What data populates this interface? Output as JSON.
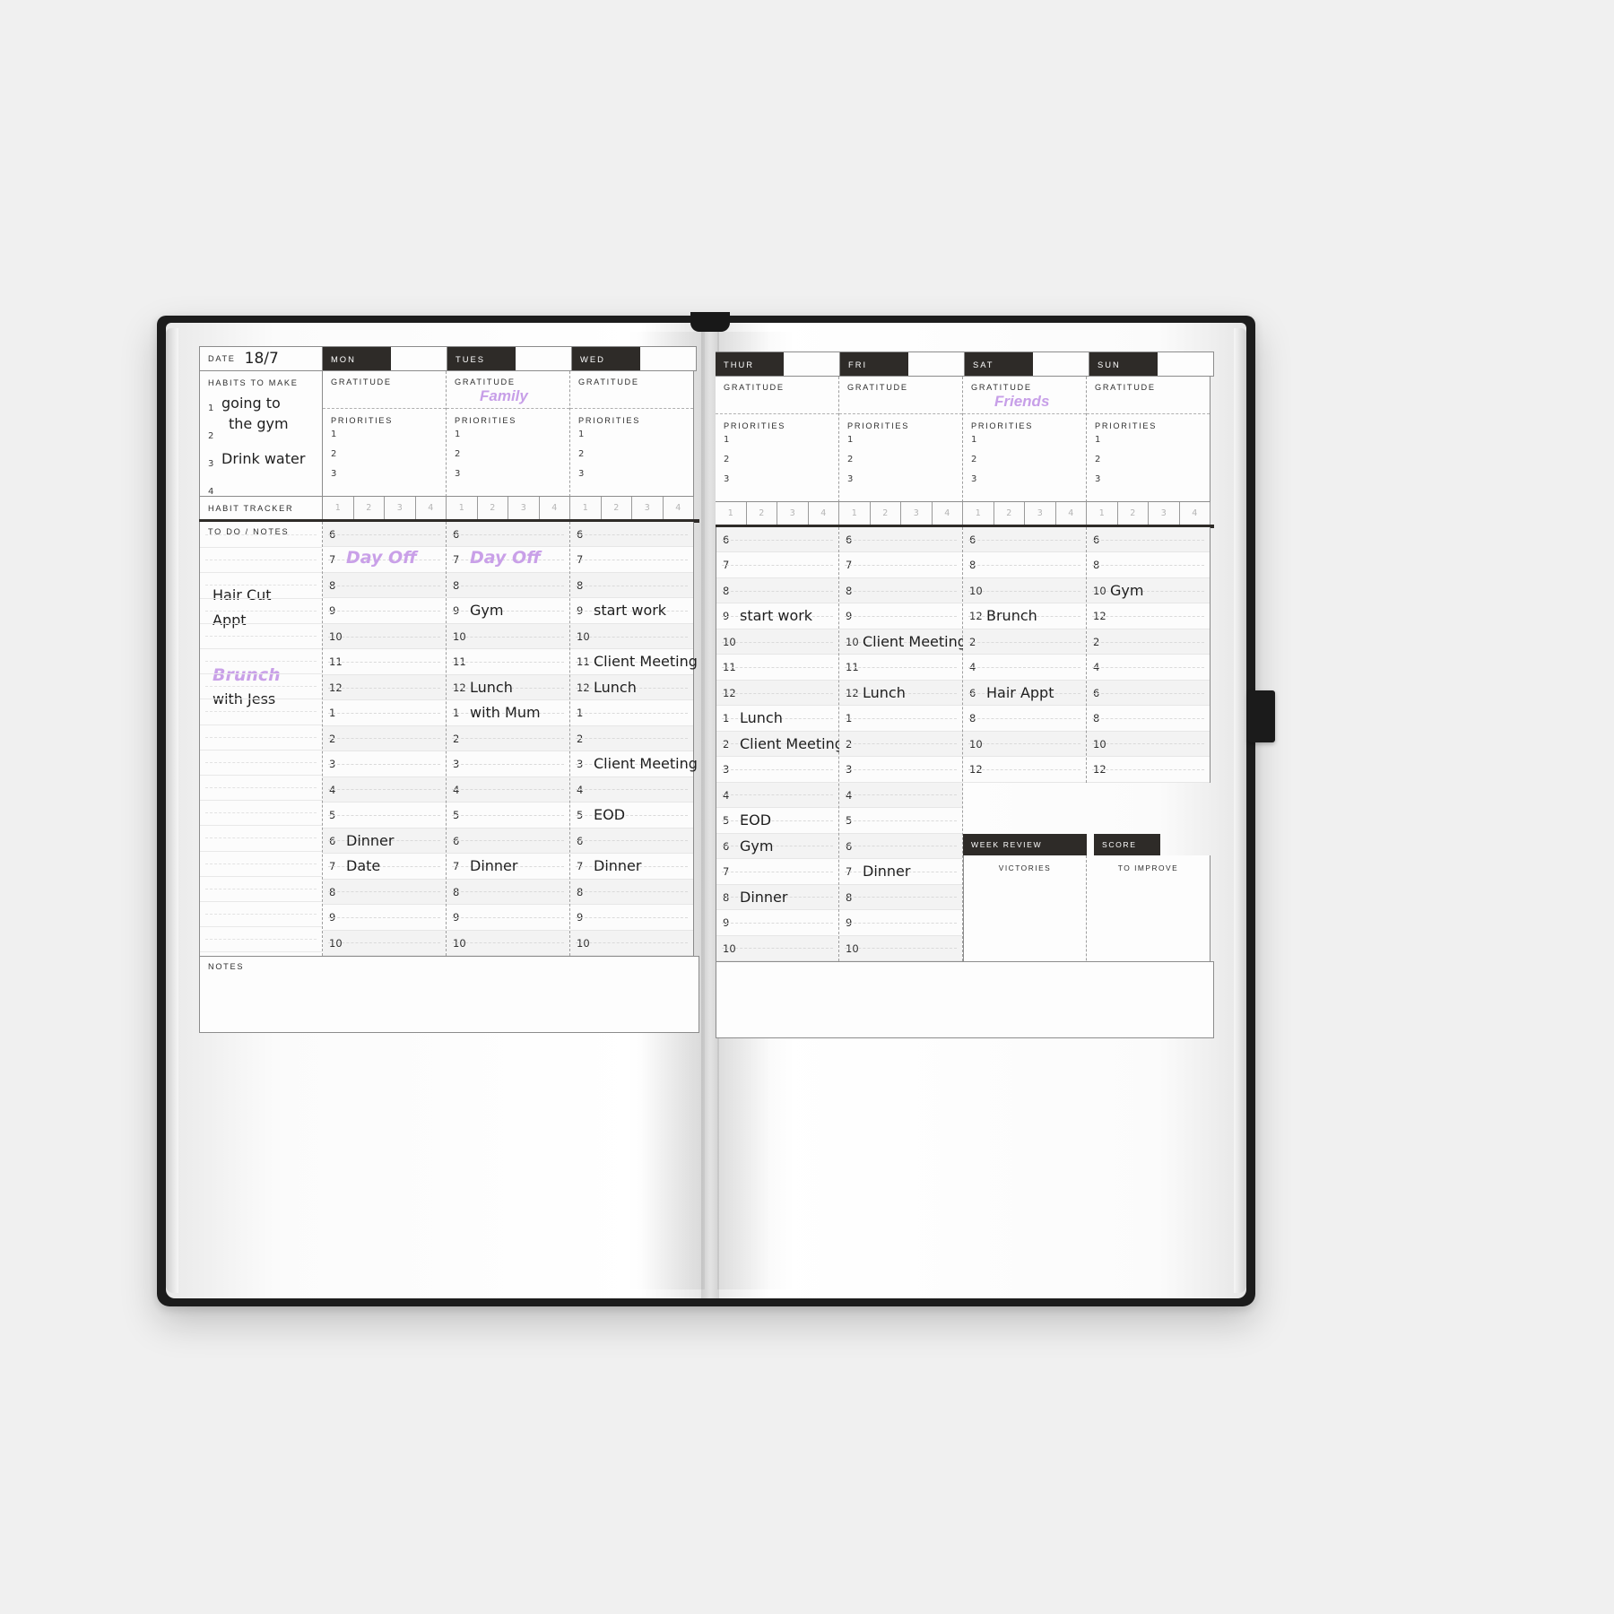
{
  "planner": {
    "date_label": "DATE",
    "date_value": "18/7",
    "habits_label": "HABITS TO MAKE",
    "habits": [
      {
        "num": "1",
        "text": "going to"
      },
      {
        "num": "2",
        "text": "the gym"
      },
      {
        "num": "3",
        "text": "Drink water"
      },
      {
        "num": "4",
        "text": ""
      }
    ],
    "habit_tracker_label": "HABIT TRACKER",
    "habit_tracker_nums": [
      "1",
      "2",
      "3",
      "4"
    ],
    "gratitude_label": "GRATITUDE",
    "priorities_label": "PRIORITIES",
    "priority_nums": [
      "1",
      "2",
      "3"
    ],
    "todo_label": "TO DO / NOTES",
    "notes_label": "NOTES",
    "todo_entries": [
      {
        "text": "Hair Cut",
        "style": "ink"
      },
      {
        "text": "Appt",
        "style": "ink"
      },
      {
        "text": "Brunch",
        "style": "purple"
      },
      {
        "text": "with Jess",
        "style": "ink"
      }
    ],
    "week_review": {
      "title": "WEEK REVIEW",
      "score": "SCORE",
      "victories": "VICTORIES",
      "to_improve": "TO IMPROVE"
    },
    "days": [
      {
        "key": "mon",
        "name": "MON",
        "gratitude_value": "",
        "hours": [
          "6",
          "7",
          "8",
          "9",
          "10",
          "11",
          "12",
          "1",
          "2",
          "3",
          "4",
          "5",
          "6",
          "7",
          "8",
          "9",
          "10"
        ],
        "entries": {
          "7": {
            "text": "Day Off",
            "style": "purple"
          },
          "6b": {
            "text": "Dinner",
            "style": "ink"
          },
          "7b": {
            "text": "Date",
            "style": "ink"
          }
        }
      },
      {
        "key": "tues",
        "name": "TUES",
        "gratitude_value": "Family",
        "hours": [
          "6",
          "7",
          "8",
          "9",
          "10",
          "11",
          "12",
          "1",
          "2",
          "3",
          "4",
          "5",
          "6",
          "7",
          "8",
          "9",
          "10"
        ],
        "entries": {
          "7": {
            "text": "Day Off",
            "style": "purple"
          },
          "9": {
            "text": "Gym",
            "style": "ink"
          },
          "12": {
            "text": "Lunch",
            "style": "ink"
          },
          "1": {
            "text": "with Mum",
            "style": "ink"
          },
          "7b": {
            "text": "Dinner",
            "style": "ink"
          }
        }
      },
      {
        "key": "wed",
        "name": "WED",
        "gratitude_value": "",
        "hours": [
          "6",
          "7",
          "8",
          "9",
          "10",
          "11",
          "12",
          "1",
          "2",
          "3",
          "4",
          "5",
          "6",
          "7",
          "8",
          "9",
          "10"
        ],
        "entries": {
          "9": {
            "text": "start work",
            "style": "ink"
          },
          "11": {
            "text": "Client Meeting",
            "style": "ink"
          },
          "12": {
            "text": "Lunch",
            "style": "ink"
          },
          "3": {
            "text": "Client Meeting",
            "style": "ink"
          },
          "5": {
            "text": "EOD",
            "style": "ink"
          },
          "7b": {
            "text": "Dinner",
            "style": "ink"
          }
        }
      },
      {
        "key": "thur",
        "name": "THUR",
        "gratitude_value": "",
        "hours": [
          "6",
          "7",
          "8",
          "9",
          "10",
          "11",
          "12",
          "1",
          "2",
          "3",
          "4",
          "5",
          "6",
          "7",
          "8",
          "9",
          "10"
        ],
        "entries": {
          "9": {
            "text": "start work",
            "style": "ink"
          },
          "1": {
            "text": "Lunch",
            "style": "ink"
          },
          "2": {
            "text": "Client Meeting",
            "style": "ink"
          },
          "5": {
            "text": "EOD",
            "style": "ink"
          },
          "6b": {
            "text": "Gym",
            "style": "ink"
          },
          "8b": {
            "text": "Dinner",
            "style": "ink"
          }
        }
      },
      {
        "key": "fri",
        "name": "FRI",
        "gratitude_value": "",
        "hours": [
          "6",
          "7",
          "8",
          "9",
          "10",
          "11",
          "12",
          "1",
          "2",
          "3",
          "4",
          "5",
          "6",
          "7",
          "8",
          "9",
          "10"
        ],
        "entries": {
          "10": {
            "text": "Client Meeting",
            "style": "ink"
          },
          "12": {
            "text": "Lunch",
            "style": "ink"
          },
          "7b": {
            "text": "Dinner",
            "style": "ink"
          }
        }
      },
      {
        "key": "sat",
        "name": "SAT",
        "gratitude_value": "Friends",
        "hours": [
          "6",
          "8",
          "10",
          "12",
          "2",
          "4",
          "6",
          "8",
          "10",
          "12"
        ],
        "entries": {
          "12": {
            "text": "Brunch",
            "style": "ink"
          },
          "6b": {
            "text": "Hair Appt",
            "style": "ink"
          }
        }
      },
      {
        "key": "sun",
        "name": "SUN",
        "gratitude_value": "",
        "hours": [
          "6",
          "8",
          "10",
          "12",
          "2",
          "4",
          "6",
          "8",
          "10",
          "12"
        ],
        "entries": {
          "10": {
            "text": "Gym",
            "style": "ink"
          }
        }
      }
    ]
  }
}
